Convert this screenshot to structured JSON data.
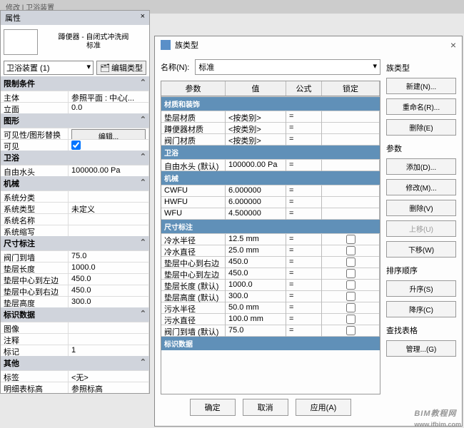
{
  "topbar": "修改 | 卫浴装置",
  "propPanel": {
    "title": "属性",
    "typeName": "蹲便器 - 自闭式冲洗阀\n标准",
    "comboValue": "卫浴装置 (1)",
    "editTypeBtn": "编辑类型",
    "sections": [
      {
        "name": "限制条件",
        "rows": [
          {
            "k": "主体",
            "v": "参照平面 : 中心(..."
          },
          {
            "k": "立面",
            "v": "0.0"
          }
        ]
      },
      {
        "name": "图形",
        "rows": [
          {
            "k": "可见性/图形替换",
            "v": "编辑...",
            "btn": true
          },
          {
            "k": "可见",
            "v": "",
            "check": true
          }
        ]
      },
      {
        "name": "卫浴",
        "rows": [
          {
            "k": "自由水头",
            "v": "100000.00 Pa"
          }
        ]
      },
      {
        "name": "机械",
        "rows": [
          {
            "k": "系统分类",
            "v": ""
          },
          {
            "k": "系统类型",
            "v": "未定义"
          },
          {
            "k": "系统名称",
            "v": ""
          },
          {
            "k": "系统缩写",
            "v": ""
          }
        ]
      },
      {
        "name": "尺寸标注",
        "rows": [
          {
            "k": "阀门到墙",
            "v": "75.0"
          },
          {
            "k": "垫层长度",
            "v": "1000.0"
          },
          {
            "k": "垫层中心到左边",
            "v": "450.0"
          },
          {
            "k": "垫层中心到右边",
            "v": "450.0"
          },
          {
            "k": "垫层高度",
            "v": "300.0"
          }
        ]
      },
      {
        "name": "标识数据",
        "rows": [
          {
            "k": "图像",
            "v": ""
          },
          {
            "k": "注释",
            "v": ""
          },
          {
            "k": "标记",
            "v": "1"
          }
        ]
      },
      {
        "name": "其他",
        "rows": [
          {
            "k": "标签",
            "v": "<无>"
          },
          {
            "k": "明细表标高",
            "v": "参照标高"
          }
        ]
      }
    ]
  },
  "dialog": {
    "title": "族类型",
    "nameLabel": "名称(N):",
    "nameValue": "标准",
    "header": {
      "c1": "参数",
      "c2": "值",
      "c3": "公式",
      "c4": "锁定"
    },
    "groups": [
      {
        "name": "材质和装饰",
        "rows": [
          {
            "p": "垫层材质",
            "v": "<按类别>",
            "f": "="
          },
          {
            "p": "蹲便器材质",
            "v": "<按类别>",
            "f": "="
          },
          {
            "p": "阀门材质",
            "v": "<按类别>",
            "f": "="
          }
        ]
      },
      {
        "name": "卫浴",
        "rows": [
          {
            "p": "自由水头 (默认)",
            "v": "100000.00 Pa",
            "f": "="
          }
        ]
      },
      {
        "name": "机械",
        "rows": [
          {
            "p": "CWFU",
            "v": "6.000000",
            "f": "="
          },
          {
            "p": "HWFU",
            "v": "6.000000",
            "f": "="
          },
          {
            "p": "WFU",
            "v": "4.500000",
            "f": "="
          }
        ]
      },
      {
        "name": "尺寸标注",
        "rows": [
          {
            "p": "冷水半径",
            "v": "12.5 mm",
            "f": "=",
            "lock": true
          },
          {
            "p": "冷水直径",
            "v": "25.0 mm",
            "f": "=",
            "lock": true
          },
          {
            "p": "垫层中心到右边",
            "v": "450.0",
            "f": "=",
            "lock": true
          },
          {
            "p": "垫层中心到左边",
            "v": "450.0",
            "f": "=",
            "lock": true
          },
          {
            "p": "垫层长度 (默认)",
            "v": "1000.0",
            "f": "=",
            "lock": true
          },
          {
            "p": "垫层高度 (默认)",
            "v": "300.0",
            "f": "=",
            "lock": true
          },
          {
            "p": "污水半径",
            "v": "50.0 mm",
            "f": "=",
            "lock": true
          },
          {
            "p": "污水直径",
            "v": "100.0 mm",
            "f": "=",
            "lock": true
          },
          {
            "p": "阀门到墙 (默认)",
            "v": "75.0",
            "f": "=",
            "lock": true
          }
        ]
      },
      {
        "name": "标识数据",
        "rows": []
      }
    ],
    "right": {
      "g1": "族类型",
      "newBtn": "新建(N)...",
      "renameBtn": "重命名(R)...",
      "deleteBtn": "删除(E)",
      "g2": "参数",
      "addBtn": "添加(D)...",
      "modifyBtn": "修改(M)...",
      "removeBtn": "删除(V)",
      "upBtn": "上移(U)",
      "downBtn": "下移(W)",
      "g3": "排序顺序",
      "ascBtn": "升序(S)",
      "descBtn": "降序(C)",
      "g4": "查找表格",
      "manageBtn": "管理...(G)"
    },
    "footer": {
      "ok": "确定",
      "cancel": "取消",
      "apply": "应用(A)"
    }
  },
  "watermark": {
    "t1": "BIM教程网",
    "t2": "www.ifbim.com"
  }
}
